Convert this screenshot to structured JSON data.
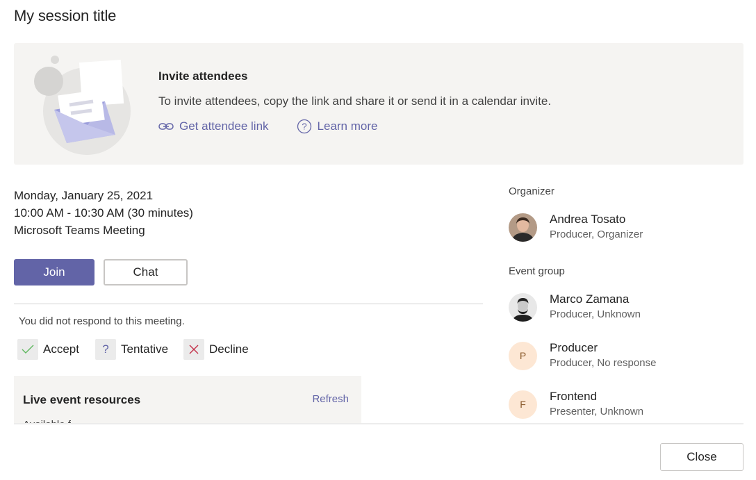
{
  "dialog": {
    "title": "My session title"
  },
  "banner": {
    "heading": "Invite attendees",
    "description": "To invite attendees, copy the link and share it or send it in a calendar invite.",
    "get_link_label": "Get attendee link",
    "learn_more_label": "Learn more"
  },
  "meeting": {
    "date": "Monday, January 25, 2021",
    "time": "10:00 AM - 10:30 AM (30 minutes)",
    "type": "Microsoft Teams Meeting"
  },
  "actions": {
    "join_label": "Join",
    "chat_label": "Chat"
  },
  "response": {
    "status_text": "You did not respond to this meeting.",
    "accept_label": "Accept",
    "tentative_label": "Tentative",
    "decline_label": "Decline"
  },
  "resources": {
    "title": "Live event resources",
    "refresh_label": "Refresh",
    "subtitle": "Available f..."
  },
  "organizer": {
    "section_label": "Organizer",
    "name": "Andrea Tosato",
    "role": "Producer, Organizer"
  },
  "event_group": {
    "section_label": "Event group",
    "members": [
      {
        "name": "Marco Zamana",
        "role": "Producer, Unknown",
        "initial": ""
      },
      {
        "name": "Producer",
        "role": "Producer, No response",
        "initial": "P"
      },
      {
        "name": "Frontend",
        "role": "Presenter, Unknown",
        "initial": "F"
      }
    ]
  },
  "footer": {
    "close_label": "Close"
  },
  "colors": {
    "brand": "#6264a7",
    "panel": "#f5f4f2",
    "initial_avatar_bg": "#fde7d4",
    "accept": "#5fb85f",
    "decline": "#c4314b"
  }
}
